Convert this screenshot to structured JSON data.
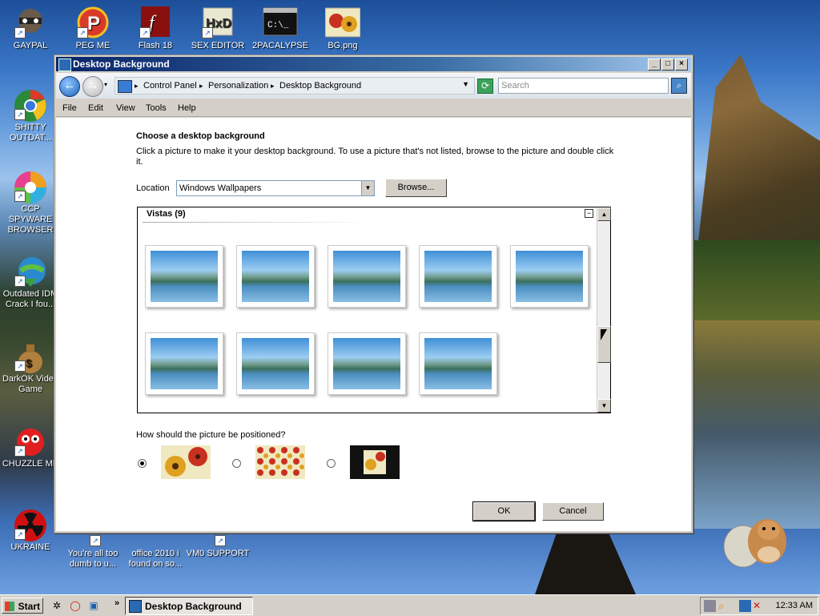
{
  "desktop": {
    "icons": [
      {
        "label": "GAYPAL",
        "icon": "raccoon-icon",
        "color": "#5a4a3a",
        "shortcut": true
      },
      {
        "label": "PEG ME",
        "icon": "p-logo-icon",
        "color": "#d93a2a",
        "shortcut": true
      },
      {
        "label": "Flash 18",
        "icon": "flash-icon",
        "color": "#8a1010",
        "shortcut": true
      },
      {
        "label": "SEX EDITOR",
        "icon": "hxd-icon",
        "color": "#e8e8d0",
        "shortcut": true
      },
      {
        "label": "2PACALYPSE",
        "icon": "terminal-icon",
        "color": "#111111",
        "shortcut": true
      },
      {
        "label": "BG.png",
        "icon": "flower-image-icon",
        "color": "#c83020",
        "shortcut": false
      },
      {
        "label": "SHITTY OUTDAT...",
        "icon": "chrome-icon",
        "color": "#2a8a3a",
        "shortcut": true
      },
      {
        "label": "CCP SPYWARE BROWSER",
        "icon": "colorful-browser-icon",
        "color": "#e84090",
        "shortcut": true
      },
      {
        "label": "Outdated IDM Crack I fou...",
        "icon": "idm-globe-icon",
        "color": "#2a8ad0",
        "shortcut": true
      },
      {
        "label": "DarkOK Video Game",
        "icon": "money-bag-icon",
        "color": "#b08040",
        "shortcut": true
      },
      {
        "label": "CHUZZLE ME",
        "icon": "chuzzle-icon",
        "color": "#e02020",
        "shortcut": true
      },
      {
        "label": "UKRAINE",
        "icon": "radiation-icon",
        "color": "#d01010",
        "shortcut": true
      },
      {
        "label": "You're all too dumb to u...",
        "icon": "app-icon",
        "color": "#d04040",
        "shortcut": true
      },
      {
        "label": "office 2010 i found on so...",
        "icon": "folder-icon",
        "color": "#e0c060",
        "shortcut": false
      },
      {
        "label": "VM0 SUPPORT",
        "icon": "document-icon",
        "color": "#f0f0f0",
        "shortcut": true
      }
    ]
  },
  "window": {
    "title": "Desktop Background",
    "controls": [
      "_",
      "□",
      "×"
    ],
    "breadcrumbs": [
      "Control Panel",
      "Personalization",
      "Desktop Background"
    ],
    "search_placeholder": "Search",
    "menu": [
      "File",
      "Edit",
      "View",
      "Tools",
      "Help"
    ]
  },
  "content": {
    "heading": "Choose a desktop background",
    "description": "Click a picture to make it your desktop background. To use a picture that's not listed, browse to the picture and double click it.",
    "location_label": "Location",
    "location_value": "Windows Wallpapers",
    "browse_label": "Browse...",
    "group_title": "Vistas (9)",
    "thumbnail_count": 9,
    "position_question": "How should the picture be positioned?",
    "position_options": [
      "stretch",
      "tile",
      "center"
    ],
    "position_selected": "stretch",
    "ok_label": "OK",
    "cancel_label": "Cancel"
  },
  "taskbar": {
    "start_label": "Start",
    "task_title": "Desktop Background",
    "clock": "12:33 AM",
    "quicklaunch_icons": [
      "gear-icon",
      "opera-icon",
      "network-icon"
    ]
  }
}
